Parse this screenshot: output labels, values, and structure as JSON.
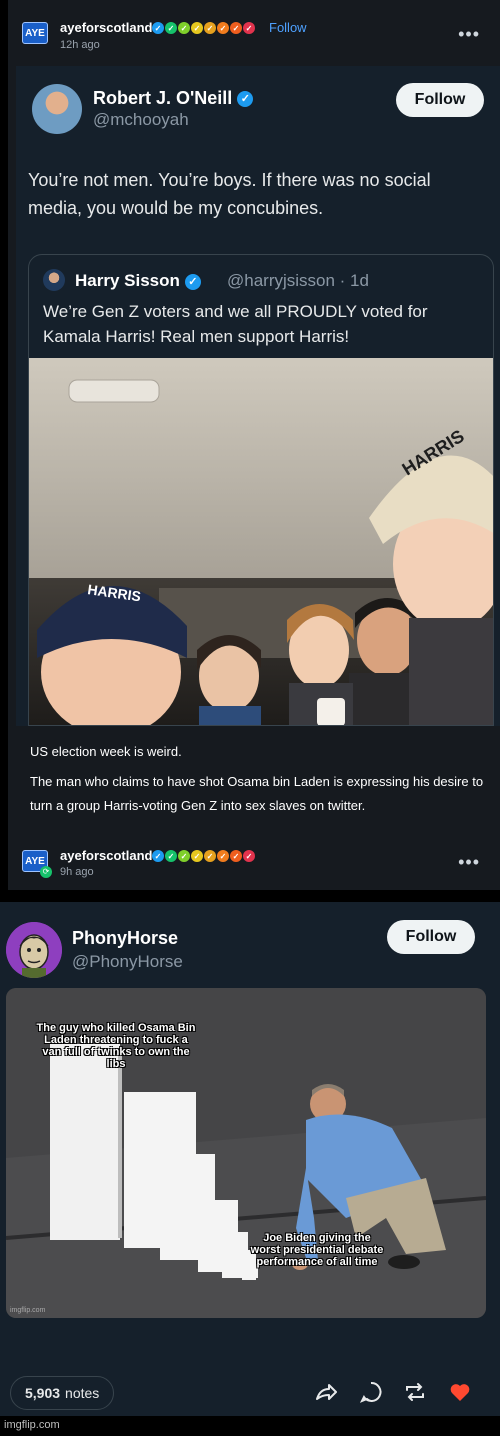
{
  "tumblr_post": {
    "icon_label": "AYE",
    "username": "ayeforscotland",
    "time": "12h ago",
    "follow_label": "Follow",
    "more_label": "•••",
    "badge_colors": [
      "#1d9bf0",
      "#16c26b",
      "#7fcf2b",
      "#e6c81f",
      "#e6a11f",
      "#f07c1e",
      "#ee5e1e",
      "#e2334d"
    ]
  },
  "tweet": {
    "name": "Robert J. O'Neill",
    "handle": "@mchooyah",
    "follow_label": "Follow",
    "text": "You’re not men. You’re boys. If there was no social media, you would be my concubines.",
    "quote": {
      "name": "Harry Sisson",
      "handle": "@harryjsisson · 1d",
      "text": "We’re Gen Z voters and we all PROUDLY voted for Kamala Harris! Real men support Harris!",
      "cap_text_1": "HARRIS",
      "cap_text_2": "HARRIS"
    }
  },
  "caption": {
    "line1": "US election week is weird.",
    "line2": "The man who claims to have shot Osama bin Laden is expressing his desire to turn a group Harris-voting Gen Z into sex slaves on twitter."
  },
  "reblog": {
    "icon_label": "AYE",
    "username": "ayeforscotland",
    "time": "9h ago",
    "more_label": "•••"
  },
  "tweet2": {
    "name": "PhonyHorse",
    "handle": "@PhonyHorse",
    "follow_label": "Follow",
    "meme_top": "The guy who killed Osama Bin Laden threatening to fuck a van full of twinks to own the libs",
    "meme_bottom": "Joe Biden giving the worst presidential debate performance of all time",
    "meme_watermark": "imgflip.com"
  },
  "footer": {
    "notes_count": "5,903",
    "notes_label": "notes",
    "heart_color": "#ff4930"
  },
  "imgflip": "imgflip.com"
}
